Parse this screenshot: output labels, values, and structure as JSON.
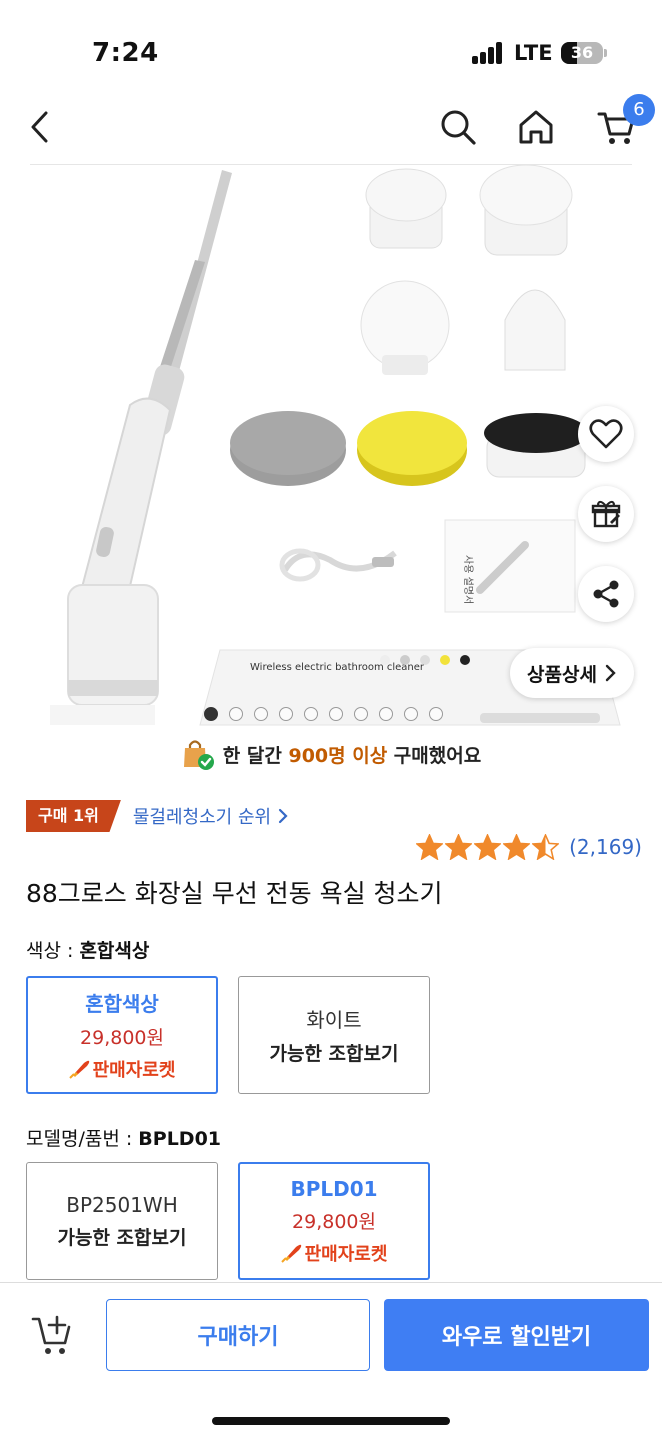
{
  "status": {
    "time": "7:24",
    "network": "LTE",
    "battery": "36"
  },
  "nav": {
    "cart_count": "6"
  },
  "gallery": {
    "detail_label": "상품상세",
    "slide_count": 10,
    "active_slide": 1,
    "package_text": "Wireless electric bathroom cleaner",
    "manual_text": "사용 설명서"
  },
  "purchase_note": {
    "prefix": "한 달간 ",
    "highlight": "900명 이상",
    "suffix": " 구매했어요"
  },
  "rank": {
    "badge": "구매 1위",
    "link": "물걸레청소기 순위"
  },
  "rating": {
    "stars": 4.5,
    "count": "(2,169)"
  },
  "product": {
    "title": "88그로스 화장실 무선 전동 욕실 청소기"
  },
  "color_option": {
    "label": "색상 : ",
    "selected": "혼합색상",
    "choices": [
      {
        "name": "혼합색상",
        "price": "29,800원",
        "badge": "판매자로켓"
      },
      {
        "name": "화이트",
        "sub": "가능한 조합보기"
      }
    ]
  },
  "model_option": {
    "label": "모델명/품번 : ",
    "selected": "BPLD01",
    "choices": [
      {
        "name": "BP2501WH",
        "sub": "가능한 조합보기"
      },
      {
        "name": "BPLD01",
        "price": "29,800원",
        "badge": "판매자로켓"
      }
    ]
  },
  "actions": {
    "buy": "구매하기",
    "wow": "와우로 할인받기"
  },
  "colors": {
    "accent": "#3b7ded",
    "price": "#c8312a",
    "rank": "#c7451a",
    "star": "#f0892b"
  }
}
